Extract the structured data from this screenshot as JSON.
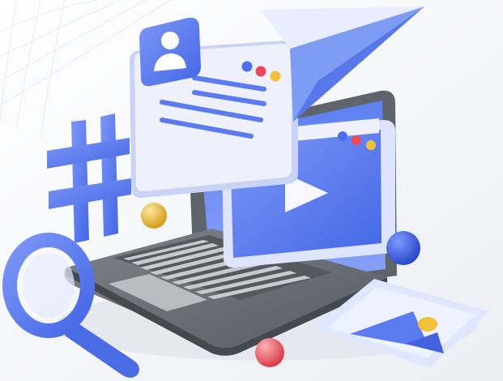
{
  "scene": {
    "description_tags": [
      "laptop",
      "profile-card",
      "video-window",
      "paper-plane",
      "hashtag",
      "magnifier",
      "image-card",
      "spheres"
    ],
    "colors": {
      "background": "#f4f5f9",
      "accent_blue": "#5b7cf0",
      "deep_blue": "#3d5fe0",
      "light_blue": "#dfe6ff",
      "window_face": "#eef1fb",
      "laptop_grey": "#6b7079",
      "laptop_dark": "#4e535b",
      "key_light": "#c9ccd2",
      "dot_blue": "#4b6ff0",
      "dot_red": "#e84a5a",
      "dot_yellow": "#f2c13a",
      "sphere_yellow": "#e3b73a",
      "sphere_blue": "#3c5fdf",
      "sphere_red": "#ef5a62"
    },
    "icons": [
      "user-icon",
      "play-icon",
      "hashtag-icon",
      "magnifier-icon",
      "image-icon",
      "paper-plane-icon"
    ]
  }
}
